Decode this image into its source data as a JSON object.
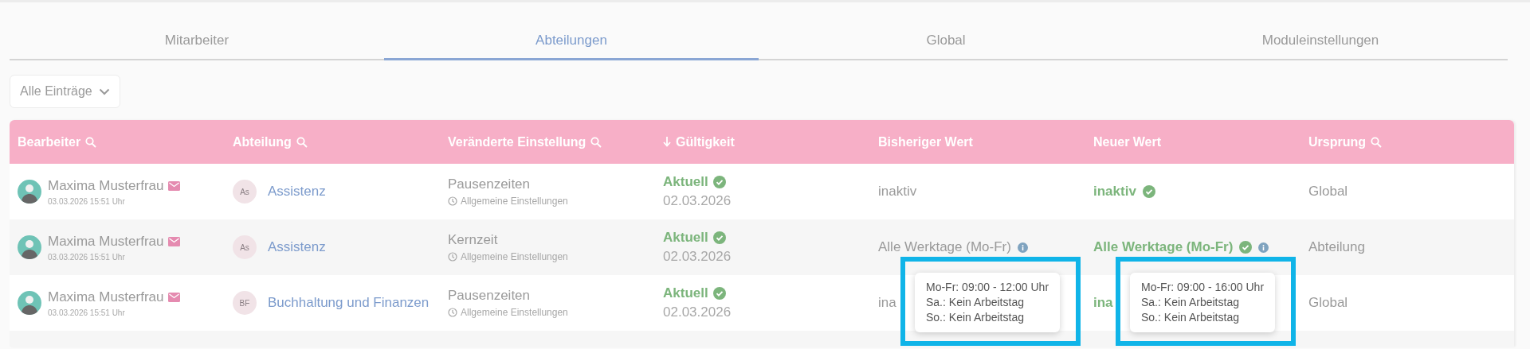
{
  "tabs": [
    {
      "label": "Mitarbeiter",
      "selected": false
    },
    {
      "label": "Abteilungen",
      "selected": true
    },
    {
      "label": "Global",
      "selected": false
    },
    {
      "label": "Moduleinstellungen",
      "selected": false
    }
  ],
  "filter": {
    "value": "Alle Einträge"
  },
  "table": {
    "columns": [
      {
        "label": "Bearbeiter",
        "searchable": true
      },
      {
        "label": "Abteilung",
        "searchable": true
      },
      {
        "label": "Veränderte Einstellung",
        "searchable": true
      },
      {
        "label": "Gültigkeit",
        "searchable": false,
        "sorted": true
      },
      {
        "label": "Bisheriger Wert",
        "searchable": false
      },
      {
        "label": "Neuer Wert",
        "searchable": false
      },
      {
        "label": "Ursprung",
        "searchable": true
      }
    ],
    "rows": [
      {
        "editor": {
          "name": "Maxima Musterfrau",
          "timestamp": "03.03.2026 15:51 Uhr"
        },
        "department": {
          "initials": "As",
          "name": "Assistenz"
        },
        "setting": {
          "name": "Pausenzeiten",
          "category": "Allgemeine Einstellungen"
        },
        "validity": {
          "status": "Aktuell",
          "date": "02.03.2026"
        },
        "old_value": {
          "text": "inaktiv",
          "info": false
        },
        "new_value": {
          "text": "inaktiv",
          "confirmed": true,
          "info": false
        },
        "origin": "Global"
      },
      {
        "editor": {
          "name": "Maxima Musterfrau",
          "timestamp": "03.03.2026 15:51 Uhr"
        },
        "department": {
          "initials": "As",
          "name": "Assistenz"
        },
        "setting": {
          "name": "Kernzeit",
          "category": "Allgemeine Einstellungen"
        },
        "validity": {
          "status": "Aktuell",
          "date": "02.03.2026"
        },
        "old_value": {
          "text": "Alle Werktage (Mo-Fr)",
          "info": true,
          "tooltip": {
            "highlighted": true,
            "lines": [
              "Mo-Fr: 09:00 - 12:00 Uhr",
              "Sa.: Kein Arbeitstag",
              "So.: Kein Arbeitstag"
            ]
          }
        },
        "new_value": {
          "text": "Alle Werktage (Mo-Fr)",
          "confirmed": true,
          "info": true,
          "tooltip": {
            "highlighted": true,
            "lines": [
              "Mo-Fr: 09:00 - 16:00 Uhr",
              "Sa.: Kein Arbeitstag",
              "So.: Kein Arbeitstag"
            ]
          }
        },
        "origin": "Abteilung"
      },
      {
        "editor": {
          "name": "Maxima Musterfrau",
          "timestamp": "03.03.2026 15:51 Uhr"
        },
        "department": {
          "initials": "BF",
          "name": "Buchhaltung und Finanzen"
        },
        "setting": {
          "name": "Pausenzeiten",
          "category": "Allgemeine Einstellungen"
        },
        "validity": {
          "status": "Aktuell",
          "date": "02.03.2026"
        },
        "old_value": {
          "text": "ina",
          "info": false
        },
        "new_value": {
          "text": "ina",
          "confirmed": false,
          "info": false
        },
        "origin": "Global"
      }
    ]
  }
}
